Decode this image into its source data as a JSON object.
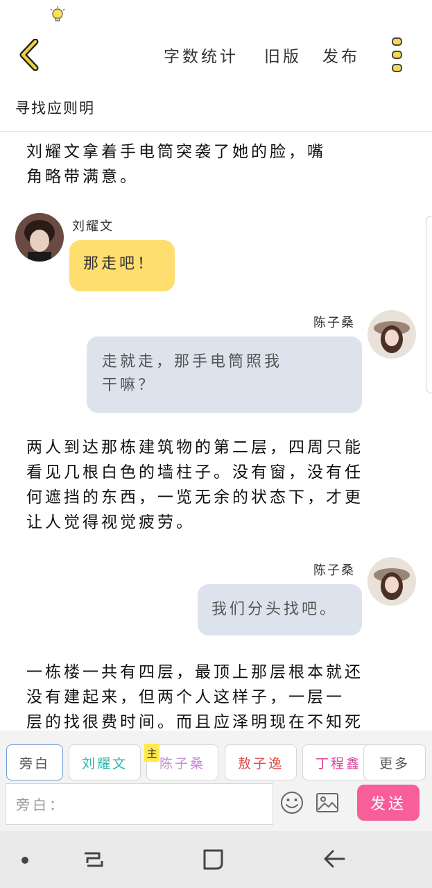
{
  "status_bar": {
    "icon": "lightbulb-icon"
  },
  "header": {
    "back_icon": "chevron-left-icon",
    "word_count": "字数统计",
    "old_version": "旧版",
    "publish": "发布",
    "menu_icon": "more-vertical-icon",
    "accent_color": "#f0cf3a"
  },
  "title": "寻找应则明",
  "story": [
    {
      "type": "narration",
      "lines": [
        "刘耀文拿着手电筒突袭了她的脸，嘴",
        "角略带满意。"
      ]
    },
    {
      "type": "dialogue",
      "side": "left",
      "speaker": "刘耀文",
      "lines": [
        "那走吧！"
      ]
    },
    {
      "type": "dialogue",
      "side": "right",
      "speaker": "陈子桑",
      "lines": [
        "走就走，那手电筒照我",
        "干嘛？"
      ]
    },
    {
      "type": "narration",
      "lines": [
        "两人到达那栋建筑物的第二层，四周只能",
        "看见几根白色的墙柱子。没有窗，没有任",
        "何遮挡的东西，一览无余的状态下，才更",
        "让人觉得视觉疲劳。"
      ]
    },
    {
      "type": "dialogue",
      "side": "right",
      "speaker": "陈子桑",
      "lines": [
        "我们分头找吧。"
      ]
    },
    {
      "type": "narration",
      "lines": [
        "一栋楼一共有四层，最顶上那层根本就还",
        "没有建起来，但两个人这样子，一层一",
        "层的找很费时间。而且应泽明现在不知死"
      ]
    }
  ],
  "characters": [
    {
      "label": "旁白",
      "color": "#555555",
      "active": true
    },
    {
      "label": "刘耀文",
      "color": "#2bb8a8",
      "active": false
    },
    {
      "label": "陈子桑",
      "color": "#c98ad8",
      "active": false,
      "badge": "主"
    },
    {
      "label": "敖子逸",
      "color": "#e24a4a",
      "active": false
    },
    {
      "label": "丁程鑫",
      "color": "#e0409a",
      "active": false
    },
    {
      "label": "更多",
      "color": "#555555",
      "active": false
    }
  ],
  "input": {
    "placeholder": "旁白："
  },
  "tools": {
    "emoji_icon": "smiley-icon",
    "image_icon": "image-icon"
  },
  "send": {
    "label": "发送",
    "color": "#f75e9a"
  },
  "nav": {
    "recent_icon": "recent-apps-icon",
    "home_icon": "home-icon",
    "back_icon": "back-arrow-icon"
  }
}
